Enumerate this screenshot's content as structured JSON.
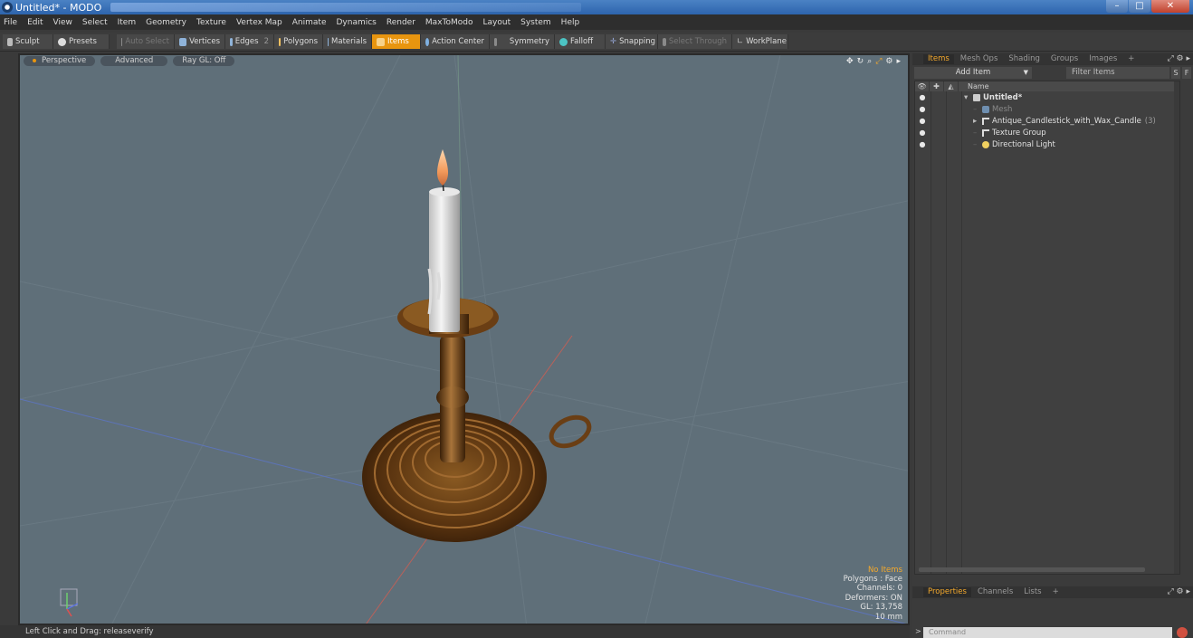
{
  "window": {
    "title": "Untitled* - MODO",
    "buttons": [
      "–",
      "□",
      "✕"
    ]
  },
  "menu": [
    "File",
    "Edit",
    "View",
    "Select",
    "Item",
    "Geometry",
    "Texture",
    "Vertex Map",
    "Animate",
    "Dynamics",
    "Render",
    "MaxToModo",
    "Layout",
    "System",
    "Help"
  ],
  "toolbar": {
    "sculpt": "Sculpt",
    "presets": "Presets",
    "auto_select": "Auto Select",
    "vertices": "Vertices",
    "edges": "Edges",
    "edges_count": "2",
    "polygons": "Polygons",
    "materials": "Materials",
    "items": "Items",
    "action_center": "Action Center",
    "symmetry": "Symmetry",
    "falloff": "Falloff",
    "snapping": "Snapping",
    "select_through": "Select Through",
    "workplane": "WorkPlane"
  },
  "viewport": {
    "tabs": [
      "Perspective",
      "Advanced",
      "Ray GL: Off"
    ],
    "stats": {
      "no_items": "No Items",
      "polygons": "Polygons : Face",
      "channels": "Channels: 0",
      "deformers": "Deformers: ON",
      "gl": "GL: 13,758",
      "scale": "10 mm"
    }
  },
  "status_bar": "Left Click and Drag:  releaseverify",
  "right_panel": {
    "tabs": [
      "Items",
      "Mesh Ops",
      "Shading",
      "Groups",
      "Images",
      "+"
    ],
    "add_item": "Add Item",
    "filter_placeholder": "Filter Items",
    "s_button": "S",
    "f_button": "F",
    "tree_header": "Name",
    "tree": [
      {
        "label": "Untitled*",
        "count": "",
        "indent": 0,
        "expand": "▾",
        "style": "bold"
      },
      {
        "label": "Mesh",
        "count": "",
        "indent": 1,
        "expand": "",
        "style": "dim"
      },
      {
        "label": "Antique_Candlestick_with_Wax_Candle",
        "count": "(3)",
        "indent": 1,
        "expand": "▸",
        "style": ""
      },
      {
        "label": "Texture Group",
        "count": "",
        "indent": 1,
        "expand": "",
        "style": ""
      },
      {
        "label": "Directional Light",
        "count": "",
        "indent": 1,
        "expand": "",
        "style": ""
      }
    ],
    "bottom_tabs": [
      "Properties",
      "Channels",
      "Lists",
      "+"
    ],
    "command_placeholder": "Command",
    "command_prompt": ">"
  },
  "colors": {
    "accent": "#e8950f",
    "viewport_bg": "#5f6f79",
    "panel_bg": "#3b3b3b"
  }
}
